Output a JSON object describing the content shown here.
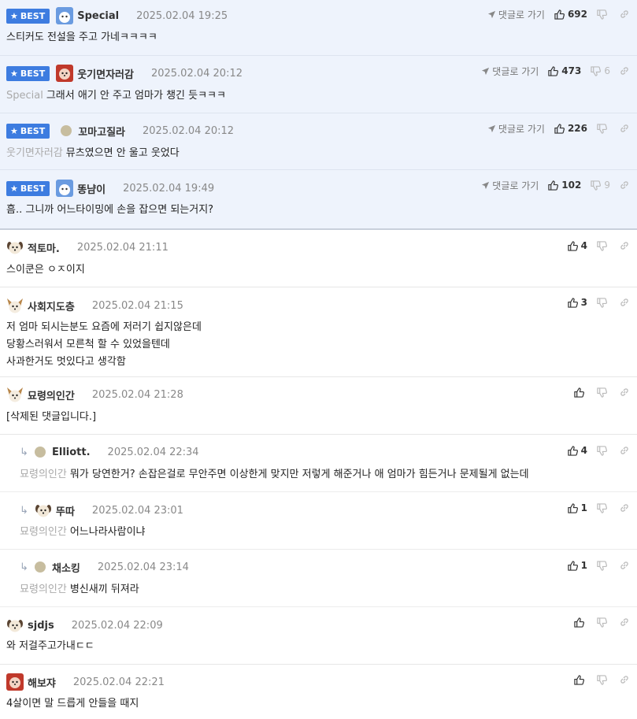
{
  "labels": {
    "best": "BEST",
    "goto": "댓글로 가기"
  },
  "comments": [
    {
      "best": true,
      "avatar": "blue-avatar",
      "nick": "Special",
      "date": "2025.02.04 19:25",
      "mention": "",
      "text": "스티커도 전설을 주고 가네ㅋㅋㅋㅋ",
      "likes": "692",
      "dislikes": ""
    },
    {
      "best": true,
      "avatar": "red-avatar",
      "nick": "웃기면자러감",
      "date": "2025.02.04 20:12",
      "mention": "Special",
      "text": "그래서 애기 안 주고 엄마가 챙긴 듯ㅋㅋㅋ",
      "likes": "473",
      "dislikes": "6"
    },
    {
      "best": true,
      "avatar": "dot-avatar",
      "nick": "꼬마고질라",
      "date": "2025.02.04 20:12",
      "mention": "웃기면자러감",
      "text": "뮤츠였으면 안 울고 웃었다",
      "likes": "226",
      "dislikes": ""
    },
    {
      "best": true,
      "avatar": "blue-avatar",
      "nick": "똥냠이",
      "date": "2025.02.04 19:49",
      "mention": "",
      "text": "흠.. 그니까 어느타이밍에 손을 잡으면 되는거지?",
      "likes": "102",
      "dislikes": "9"
    },
    {
      "best": false,
      "avatar": "dog-avatar",
      "nick": "적토마.",
      "date": "2025.02.04 21:11",
      "mention": "",
      "text": "스이쿤은 ㅇㅈ이지",
      "likes": "4",
      "dislikes": ""
    },
    {
      "best": false,
      "avatar": "fox-avatar",
      "nick": "사회지도층",
      "date": "2025.02.04 21:15",
      "mention": "",
      "text_lines": [
        "저 엄마 되시는분도 요즘에 저러기 쉽지않은데",
        "당황스러워서 모른척 할 수 있었을텐데",
        "사과한거도 멋있다고 생각함"
      ],
      "likes": "3",
      "dislikes": ""
    },
    {
      "best": false,
      "avatar": "fox-avatar",
      "nick": "묘령의인간",
      "date": "2025.02.04 21:28",
      "mention": "",
      "text": "[삭제된 댓글입니다.]",
      "likes": "",
      "dislikes": ""
    },
    {
      "best": false,
      "reply": true,
      "avatar": "dot-avatar",
      "nick": "Elliott.",
      "date": "2025.02.04 22:34",
      "mention": "묘령의인간",
      "text": "뭐가 당연한거? 손잡은걸로 무안주면 이상한게 맞지만 저렇게 해준거나 애 엄마가 힘든거나 문제될게 없는데",
      "likes": "4",
      "dislikes": ""
    },
    {
      "best": false,
      "reply": true,
      "avatar": "dog-avatar",
      "nick": "뚜따",
      "date": "2025.02.04 23:01",
      "mention": "묘령의인간",
      "text": "어느나라사람이냐",
      "likes": "1",
      "dislikes": ""
    },
    {
      "best": false,
      "reply": true,
      "avatar": "dot-avatar",
      "nick": "채소킹",
      "date": "2025.02.04 23:14",
      "mention": "묘령의인간",
      "text": "병신새끼 뒤져라",
      "likes": "1",
      "dislikes": ""
    },
    {
      "best": false,
      "avatar": "dog-avatar",
      "nick": "sjdjs",
      "date": "2025.02.04 22:09",
      "mention": "",
      "text": "와 저걸주고가내ㄷㄷ",
      "likes": "",
      "dislikes": ""
    },
    {
      "best": false,
      "avatar": "red-avatar",
      "nick": "해보쟈",
      "date": "2025.02.04 22:21",
      "mention": "",
      "text": "4살이면 말 드릅게 안들을 때지",
      "likes": "",
      "dislikes": ""
    }
  ]
}
